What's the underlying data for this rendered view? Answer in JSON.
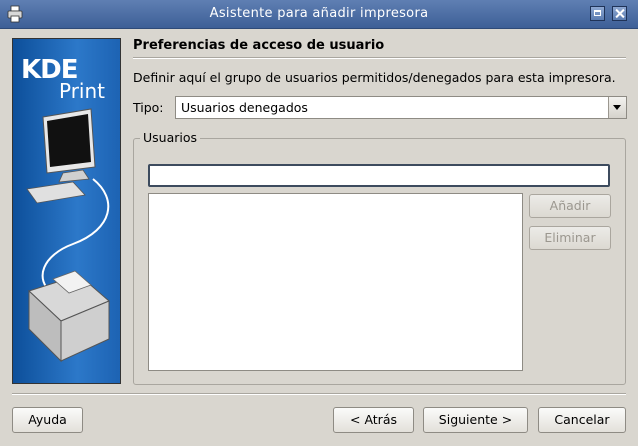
{
  "window": {
    "title": "Asistente para añadir impresora",
    "icons": {
      "app": "printer-icon",
      "maximize": "maximize-icon",
      "close": "close-icon"
    }
  },
  "sidebar": {
    "logo_kde": "KDE",
    "logo_print": "Print"
  },
  "page": {
    "heading": "Preferencias de acceso de usuario",
    "description": "Definir aquí el grupo de usuarios permitidos/denegados para esta impresora.",
    "tipo_label": "Tipo:",
    "tipo_value": "Usuarios denegados",
    "group_label": "Usuarios",
    "user_input_value": "",
    "add_button": "Añadir",
    "remove_button": "Eliminar"
  },
  "footer": {
    "help": "Ayuda",
    "back": "< Atrás",
    "next": "Siguiente >",
    "cancel": "Cancelar"
  }
}
